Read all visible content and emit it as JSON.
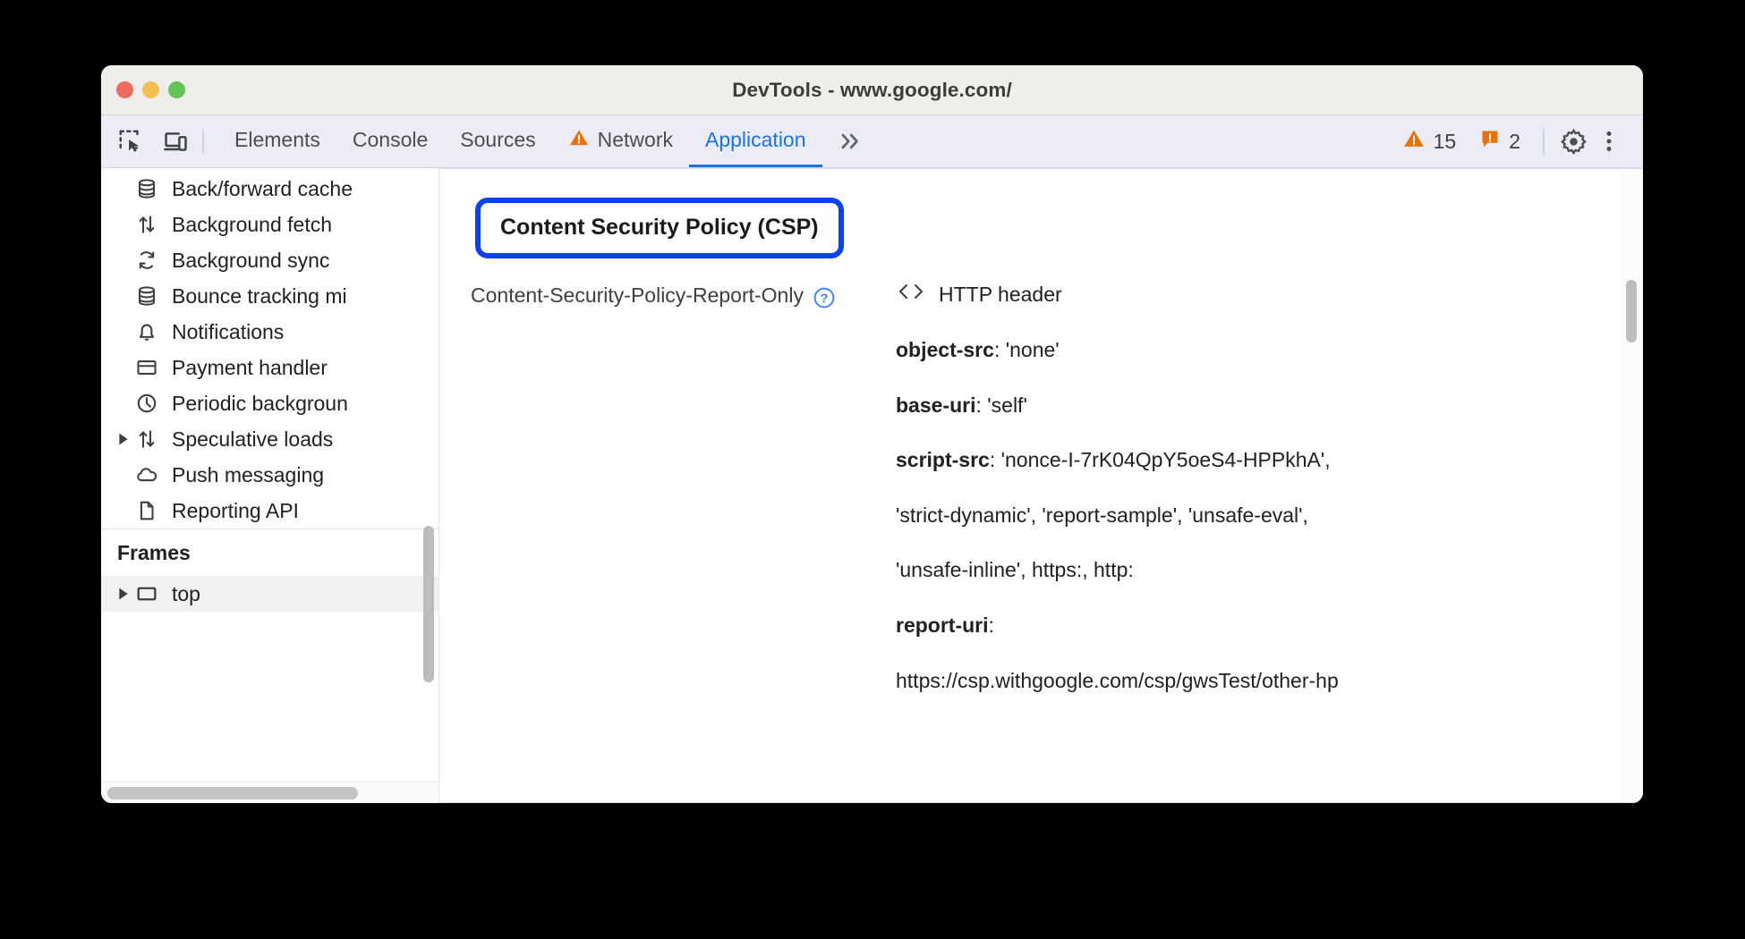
{
  "window": {
    "title": "DevTools - www.google.com/",
    "traffic_lights": [
      "close",
      "minimize",
      "maximize"
    ]
  },
  "toolbar": {
    "left_icons": [
      {
        "name": "inspect-element-icon",
        "label": "Inspect element"
      },
      {
        "name": "device-toolbar-icon",
        "label": "Toggle device toolbar"
      }
    ],
    "tabs": [
      {
        "label": "Elements",
        "selected": false,
        "warning": false
      },
      {
        "label": "Console",
        "selected": false,
        "warning": false
      },
      {
        "label": "Sources",
        "selected": false,
        "warning": false
      },
      {
        "label": "Network",
        "selected": false,
        "warning": true
      },
      {
        "label": "Application",
        "selected": true,
        "warning": false
      }
    ],
    "more_tabs_label": "»",
    "warning_count": "15",
    "issue_count": "2",
    "settings_label": "Settings",
    "more_options_label": "Customize and control DevTools",
    "accent_color": "#1a73e8",
    "warning_color": "#e8710a"
  },
  "sidebar": {
    "items": [
      {
        "label": "Back/forward cache",
        "icon": "database-icon",
        "expandable": false,
        "selected": false
      },
      {
        "label": "Background fetch",
        "icon": "updown-arrows-icon",
        "expandable": false,
        "selected": false
      },
      {
        "label": "Background sync",
        "icon": "sync-icon",
        "expandable": false,
        "selected": false
      },
      {
        "label": "Bounce tracking mi",
        "icon": "database-icon",
        "expandable": false,
        "selected": false
      },
      {
        "label": "Notifications",
        "icon": "bell-icon",
        "expandable": false,
        "selected": false
      },
      {
        "label": "Payment handler",
        "icon": "credit-card-icon",
        "expandable": false,
        "selected": false
      },
      {
        "label": "Periodic backgroun",
        "icon": "clock-icon",
        "expandable": false,
        "selected": false
      },
      {
        "label": "Speculative loads",
        "icon": "updown-arrows-icon",
        "expandable": true,
        "selected": false
      },
      {
        "label": "Push messaging",
        "icon": "cloud-icon",
        "expandable": false,
        "selected": false
      },
      {
        "label": "Reporting API",
        "icon": "document-icon",
        "expandable": false,
        "selected": false
      }
    ],
    "frames_section_title": "Frames",
    "frames": [
      {
        "label": "top",
        "icon": "frame-icon",
        "expandable": true,
        "selected": true
      }
    ]
  },
  "content": {
    "section_title": "Content Security Policy (CSP)",
    "highlight_color": "#0b41f5",
    "policy_label": "Content-Security-Policy-Report-Only",
    "help_icon_label": "Learn more about CSP",
    "source_label": "HTTP header",
    "source_icon_glyph": "‹›",
    "directives": [
      {
        "name": "object-src",
        "value": "'none'"
      },
      {
        "name": "base-uri",
        "value": "'self'"
      },
      {
        "name": "script-src",
        "value": "'nonce-I-7rK04QpY5oeS4-HPPkhA',"
      },
      {
        "name": "",
        "value": "'strict-dynamic', 'report-sample', 'unsafe-eval',"
      },
      {
        "name": "",
        "value": "'unsafe-inline', https:, http:"
      },
      {
        "name": "report-uri",
        "value": ""
      },
      {
        "name": "",
        "value": "https://csp.withgoogle.com/csp/gwsTest/other-hp"
      }
    ]
  }
}
